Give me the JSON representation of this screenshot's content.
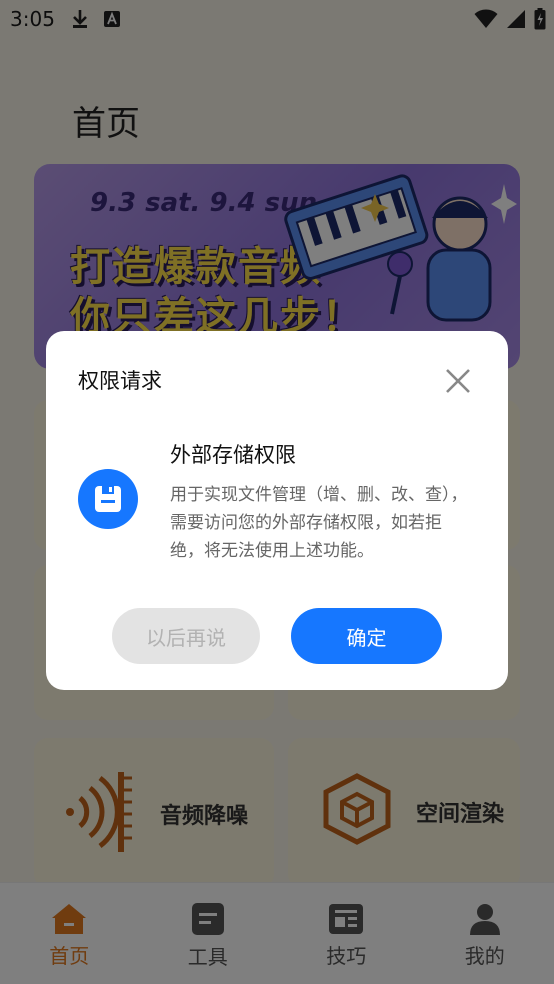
{
  "status_bar": {
    "time": "3:05",
    "icons": [
      "download-icon",
      "a-notification-icon",
      "wifi-icon",
      "signal-icon",
      "battery-icon"
    ]
  },
  "page": {
    "title": "首页"
  },
  "banner": {
    "date_text": "9.3 sat. 9.4 sun.",
    "line1": "打造爆款音频",
    "line2": "你只差这几步！"
  },
  "tool_cards": [
    {
      "label": "音频降噪",
      "icon": "sound-wave-icon"
    },
    {
      "label": "空间渲染",
      "icon": "cube-icon"
    }
  ],
  "bottom_nav": [
    {
      "label": "首页",
      "icon": "home-icon",
      "active": true
    },
    {
      "label": "工具",
      "icon": "tools-icon",
      "active": false
    },
    {
      "label": "技巧",
      "icon": "tips-icon",
      "active": false
    },
    {
      "label": "我的",
      "icon": "profile-icon",
      "active": false
    }
  ],
  "dialog": {
    "title": "权限请求",
    "permission_title": "外部存储权限",
    "permission_desc": "用于实现文件管理（增、删、改、查），需要访问您的外部存储权限，如若拒绝，将无法使用上述功能。",
    "later_button": "以后再说",
    "confirm_button": "确定"
  },
  "colors": {
    "accent": "#1677ff",
    "nav_active": "#e0781e",
    "overlay": "rgba(0,0,0,0.5)"
  }
}
